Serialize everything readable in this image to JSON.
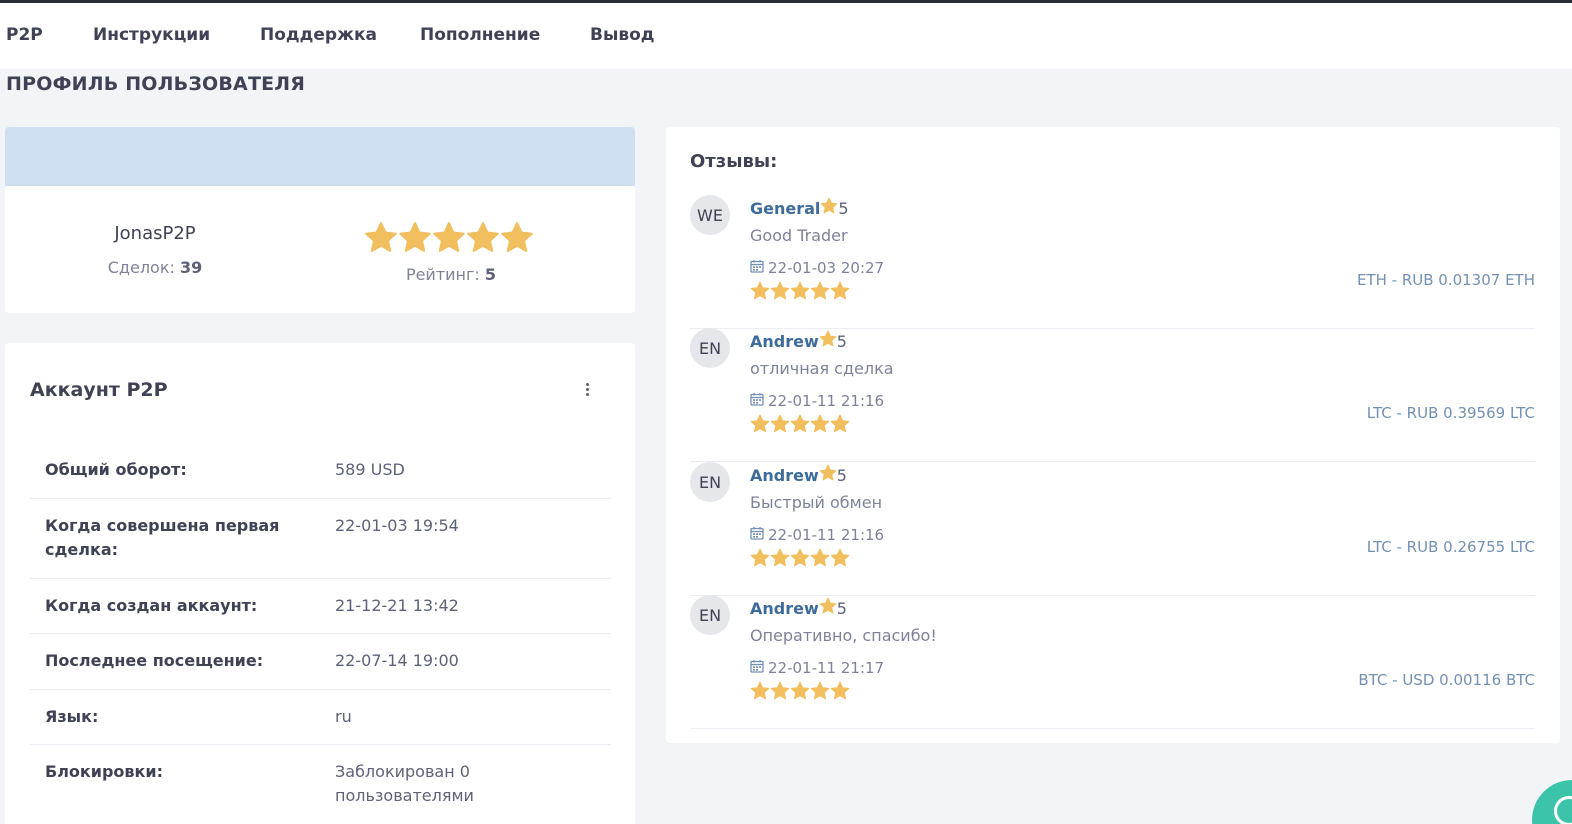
{
  "nav": {
    "items": [
      "P2P",
      "Инструкции",
      "Поддержка",
      "Пополнение",
      "Вывод"
    ]
  },
  "page_title": "ПРОФИЛЬ ПОЛЬЗОВАТЕЛЯ",
  "profile": {
    "username": "JonasP2P",
    "deals_label": "Сделок:",
    "deals_count": "39",
    "rating_label": "Рейтинг:",
    "rating_value": "5",
    "stars": 5
  },
  "account": {
    "title": "Аккаунт P2P",
    "rows": [
      {
        "label": "Общий оборот:",
        "value": "589 USD"
      },
      {
        "label": "Когда совершена первая сделка:",
        "value": "22-01-03 19:54"
      },
      {
        "label": "Когда создан аккаунт:",
        "value": "21-12-21 13:42"
      },
      {
        "label": "Последнее посещение:",
        "value": "22-07-14 19:00"
      },
      {
        "label": "Язык:",
        "value": "ru"
      },
      {
        "label": "Блокировки:",
        "value": "Заблокирован 0 пользователями"
      }
    ]
  },
  "reviews": {
    "title": "Отзывы:",
    "items": [
      {
        "initials": "WE",
        "name": "General",
        "score": "5",
        "text": "Good Trader",
        "date": "22-01-03 20:27",
        "deal": "ETH - RUB 0.01307 ETH",
        "stars": 5
      },
      {
        "initials": "EN",
        "name": "Andrew",
        "score": "5",
        "text": "отличная сделка",
        "date": "22-01-11 21:16",
        "deal": "LTC - RUB 0.39569 LTC",
        "stars": 5
      },
      {
        "initials": "EN",
        "name": "Andrew",
        "score": "5",
        "text": "Быстрый обмен",
        "date": "22-01-11 21:16",
        "deal": "LTC - RUB 0.26755 LTC",
        "stars": 5
      },
      {
        "initials": "EN",
        "name": "Andrew",
        "score": "5",
        "text": "Оперативно, спасибо!",
        "date": "22-01-11 21:17",
        "deal": "BTC - USD 0.00116 BTC",
        "stars": 5
      }
    ]
  },
  "colors": {
    "star": "#f2bf5e",
    "link": "#3e6c9a",
    "banner": "#cfdef0",
    "chat_button": "#3cc4ab"
  },
  "icons": {
    "star": "star-icon",
    "calendar": "calendar-icon",
    "more": "more-vertical-icon",
    "chat": "chat-icon"
  }
}
